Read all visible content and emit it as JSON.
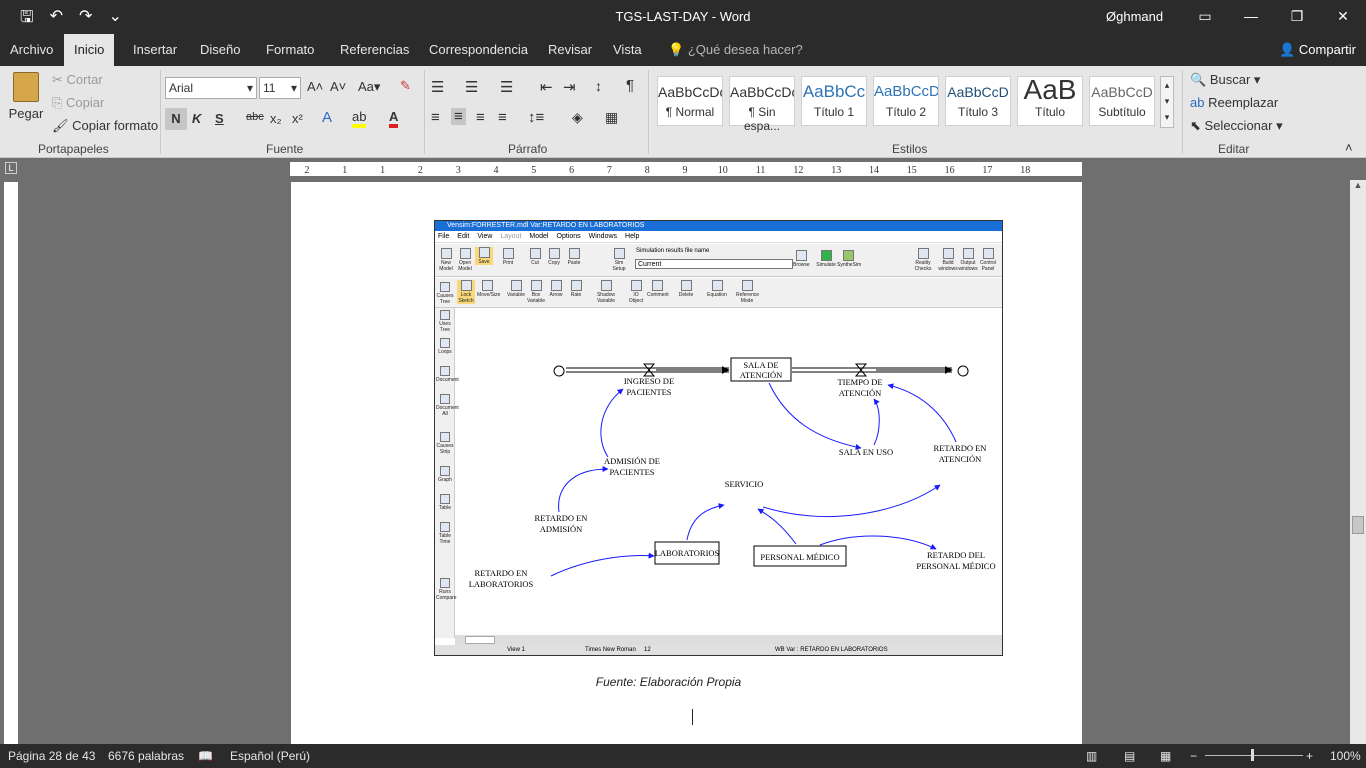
{
  "window": {
    "title": "TGS-LAST-DAY  -  Word",
    "user": "Øghmand"
  },
  "tabs": [
    "Archivo",
    "Inicio",
    "Insertar",
    "Diseño",
    "Formato",
    "Referencias",
    "Correspondencia",
    "Revisar",
    "Vista"
  ],
  "tell_me": "¿Qué desea hacer?",
  "share": "Compartir",
  "clipboard": {
    "paste": "Pegar",
    "cut": "Cortar",
    "copy": "Copiar",
    "format_painter": "Copiar formato",
    "group": "Portapapeles"
  },
  "font": {
    "name": "Arial",
    "size": "11",
    "group": "Fuente",
    "bold": "N",
    "italic": "K",
    "underline": "S",
    "strike": "abc"
  },
  "paragraph": {
    "group": "Párrafo"
  },
  "styles": {
    "group": "Estilos",
    "items": [
      {
        "preview": "AaBbCcDc",
        "name": "¶ Normal"
      },
      {
        "preview": "AaBbCcDc",
        "name": "¶ Sin espa..."
      },
      {
        "preview": "AaBbCc",
        "name": "Título 1"
      },
      {
        "preview": "AaBbCcD",
        "name": "Título 2"
      },
      {
        "preview": "AaBbCcD",
        "name": "Título 3"
      },
      {
        "preview": "AaB",
        "name": "Título"
      },
      {
        "preview": "AaBbCcD",
        "name": "Subtítulo"
      }
    ]
  },
  "editing": {
    "find": "Buscar",
    "replace": "Reemplazar",
    "select": "Seleccionar",
    "group": "Editar"
  },
  "ruler_numbers": [
    "2",
    "1",
    "1",
    "2",
    "3",
    "4",
    "5",
    "6",
    "7",
    "8",
    "9",
    "10",
    "11",
    "12",
    "13",
    "14",
    "15",
    "16",
    "17",
    "18"
  ],
  "vensim": {
    "title": "Vensim:FORRESTER.mdl Var:RETARDO EN LABORATORIOS",
    "menu": [
      "File",
      "Edit",
      "View",
      "Layout",
      "Model",
      "Options",
      "Windows",
      "Help"
    ],
    "toolbar1": [
      "New Model",
      "Open Model",
      "Save",
      "Print",
      "Cut",
      "Copy",
      "Paste",
      "Sim Setup",
      "Browse",
      "Simulate",
      "SyntheSim",
      "Reality Checks",
      "Build windows",
      "Output windows",
      "Control Panel"
    ],
    "sim_label": "Simulation results file name",
    "sim_value": "Current",
    "toolbar2": [
      "Lock Sketch",
      "Move/Size",
      "Variable",
      "Box Variable",
      "Arrow",
      "Rate",
      "Shadow Variable",
      "IO Object",
      "Comment",
      "Delete",
      "Equation",
      "Reference Mode"
    ],
    "side": [
      "Causes Tree",
      "Uses Tree",
      "Loops",
      "Document",
      "Document All",
      "Causes Strip",
      "Graph",
      "Table",
      "Table Time",
      "Runs Compare"
    ],
    "status": {
      "view": "View 1",
      "font": "Times New Roman",
      "size": "12",
      "var": "WB Var : RETARDO EN LABORATORIOS"
    },
    "nodes": {
      "sala": "SALA DE",
      "sala2": "ATENCIÓN",
      "ingreso": "INGRESO DE",
      "ingreso2": "PACIENTES",
      "tiempo": "TIEMPO DE",
      "tiempo2": "ATENCIÓN",
      "salauso": "SALA EN USO",
      "retatencion": "RETARDO EN",
      "retatencion2": "ATENCIÓN",
      "admision": "ADMISIÓN DE",
      "admision2": "PACIENTES",
      "servicio": "SERVICIO",
      "retadmision": "RETARDO EN",
      "retadmision2": "ADMISIÓN",
      "lab": "LABORATORIOS",
      "personal": "PERSONAL MÉDICO",
      "retpersonal": "RETARDO DEL",
      "retpersonal2": "PERSONAL MÉDICO",
      "retlab": "RETARDO EN",
      "retlab2": "LABORATORIOS"
    }
  },
  "caption": "Fuente: Elaboración Propia",
  "status": {
    "page": "Página 28 de 43",
    "words": "6676 palabras",
    "lang": "Español (Perú)",
    "zoom": "100%"
  }
}
